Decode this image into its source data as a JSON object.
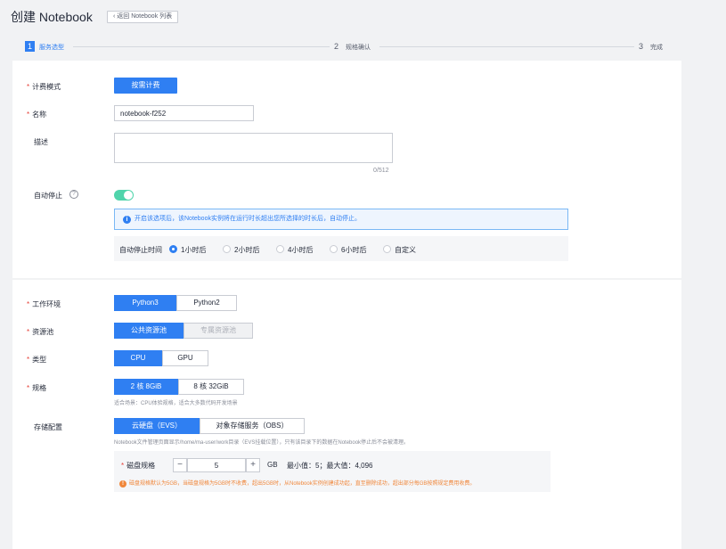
{
  "header": {
    "title": "创建 Notebook",
    "back_label": "返回 Notebook 列表",
    "back_icon": "chevron-left-icon"
  },
  "steps": [
    {
      "num": "1",
      "label": "服务选型"
    },
    {
      "num": "2",
      "label": "规格确认"
    },
    {
      "num": "3",
      "label": "完成"
    }
  ],
  "billing": {
    "label": "计费模式",
    "value": "按需计费"
  },
  "name": {
    "label": "名称",
    "value": "notebook-f252"
  },
  "description": {
    "label": "描述",
    "value": "",
    "counter": "0/512"
  },
  "auto_stop": {
    "label": "自动停止",
    "enabled": true,
    "info": "开启该选项后，该Notebook实例将在运行时长超出您所选择的时长后，自动停止。",
    "time_label": "自动停止时间",
    "options": [
      "1小时后",
      "2小时后",
      "4小时后",
      "6小时后",
      "自定义"
    ],
    "selected": "1小时后"
  },
  "environment": {
    "label": "工作环境",
    "options": [
      "Python3",
      "Python2"
    ],
    "selected": "Python3"
  },
  "resource_pool": {
    "label": "资源池",
    "options": [
      "公共资源池",
      "专属资源池"
    ],
    "selected": "公共资源池"
  },
  "type": {
    "label": "类型",
    "options": [
      "CPU",
      "GPU"
    ],
    "selected": "CPU"
  },
  "flavor": {
    "label": "规格",
    "options": [
      "2 核 8GiB",
      "8 核 32GiB"
    ],
    "selected": "2 核 8GiB",
    "hint": "适合场景：CPU体验规格，适合大多数代码开发场景"
  },
  "storage": {
    "label": "存储配置",
    "options": [
      "云硬盘（EVS）",
      "对象存储服务（OBS）"
    ],
    "selected": "云硬盘（EVS）",
    "hint": "Notebook文件管理页面显示/home/ma-user/work目录（EVS挂载位置），只有该目录下的数据在Notebook停止后不会被清理。",
    "disk_label": "磁盘规格",
    "disk_value": "5",
    "unit": "GB",
    "range": "最小值：5；最大值：4,096",
    "warning": "磁盘规格默认为5GB，当磁盘规格为5GB时不收费，超出5GB时，从Notebook实例创建成功起，直至删除成功，超出部分每GB按照规定费用收费。"
  },
  "colors": {
    "primary": "#2f7ff2",
    "toggle_on": "#50d4ab",
    "warning": "#f0873b",
    "required": "#e6423a"
  }
}
